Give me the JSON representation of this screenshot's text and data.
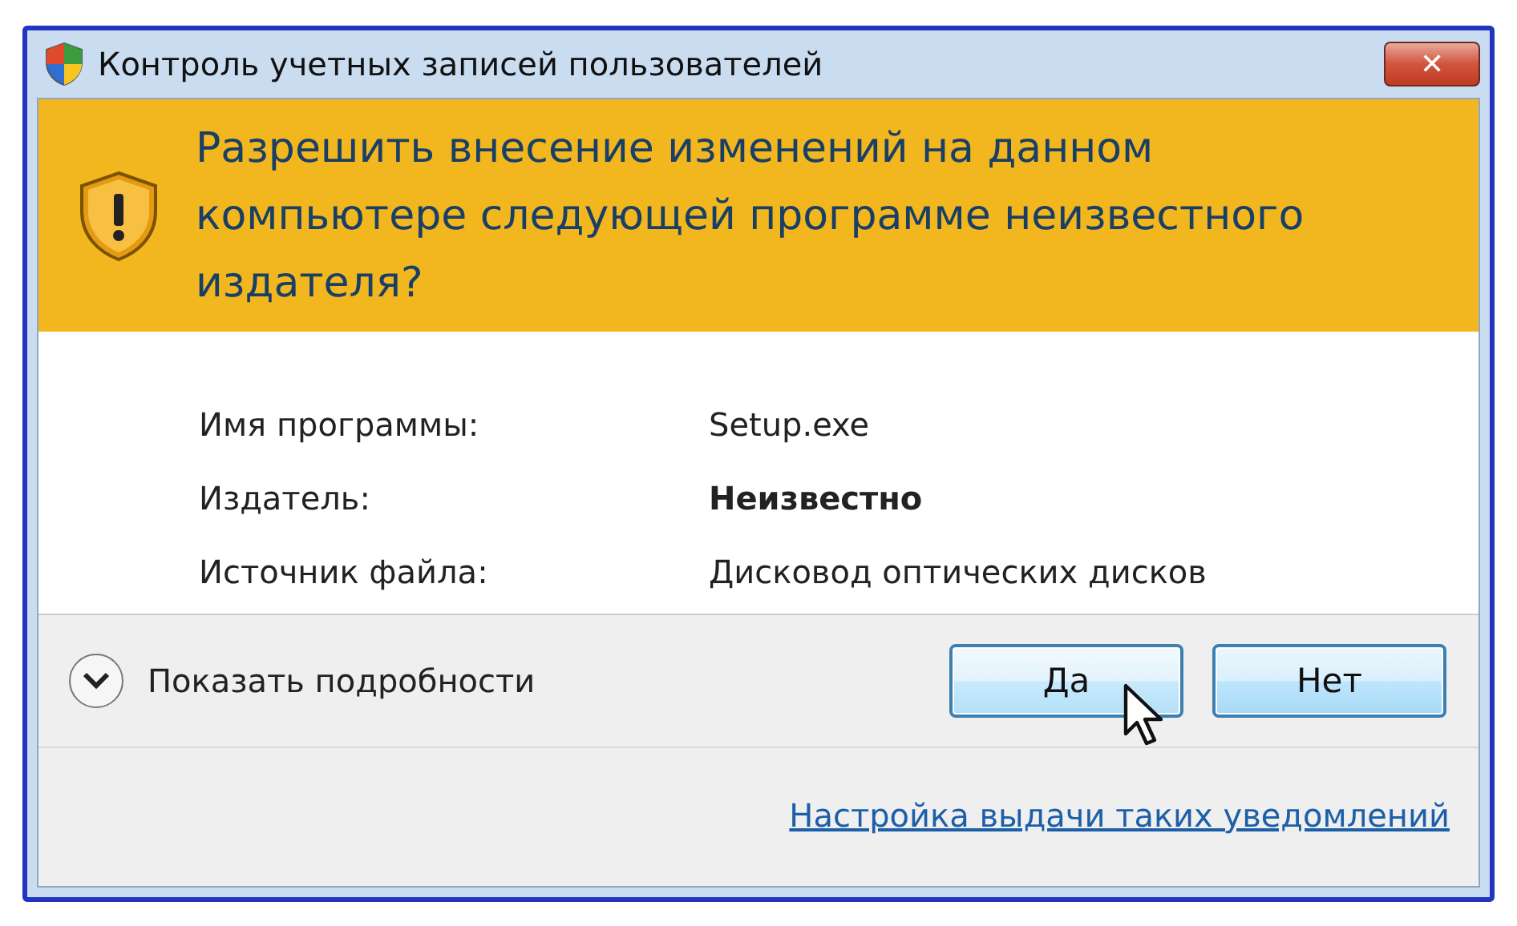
{
  "window": {
    "title": "Контроль учетных записей пользователей",
    "close_label": "✕"
  },
  "banner": {
    "question": "Разрешить внесение изменений на данном компьютере следующей программе неизвестного издателя?"
  },
  "details": [
    {
      "label": "Имя программы:",
      "value": "Setup.exe",
      "emphasis": false
    },
    {
      "label": "Издатель:",
      "value": "Неизвестно",
      "emphasis": true
    },
    {
      "label": "Источник файла:",
      "value": "Дисковод оптических дисков",
      "emphasis": false
    }
  ],
  "footer": {
    "details_toggle": {
      "label": "Показать подробности",
      "expanded": false
    },
    "buttons": [
      {
        "label": "Да",
        "hovered": true
      },
      {
        "label": "Нет",
        "hovered": false
      }
    ],
    "settings_link": "Настройка выдачи таких уведомлений"
  }
}
